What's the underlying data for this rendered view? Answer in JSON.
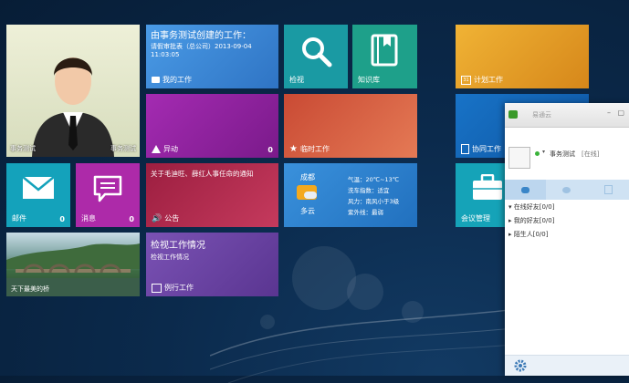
{
  "tiles": {
    "user": {
      "left_name": "事务测试",
      "right_name": "事务测试"
    },
    "workflow": {
      "title": "由事务测试创建的工作：",
      "line1": "请假审批表（总公司）2013-09-04",
      "line2": "11:03:05",
      "label": "我的工作"
    },
    "search": {
      "label": "检视"
    },
    "knowledge": {
      "label": "知识库"
    },
    "plan": {
      "label": "计划工作"
    },
    "exception": {
      "label": "异动",
      "count": "0"
    },
    "temp": {
      "label": "临时工作"
    },
    "collab": {
      "label": "协同工作"
    },
    "mail": {
      "label": "邮件",
      "count": "0"
    },
    "message": {
      "label": "消息",
      "count": "0"
    },
    "notice": {
      "text": "关于毛迪旺、薛红人事任命的通知",
      "label": "公告"
    },
    "weather": {
      "city": "成都",
      "condition": "多云",
      "temp": "气温：20℃~13℃",
      "wash": "洗车指数：适宜",
      "wind": "风力：南风小于3级",
      "uv": "紫外线：最弱"
    },
    "meeting": {
      "label": "会议管理"
    },
    "photo": {
      "caption": "天下最美的桥"
    },
    "review": {
      "title": "检视工作情况",
      "subtitle": "检视工作情况",
      "label": "例行工作"
    }
  },
  "chat": {
    "title": "易通云",
    "user": "事务测试",
    "status": "[在线]",
    "groups": [
      "在线好友[0/0]",
      "我的好友[0/0]",
      "陌生人[0/0]"
    ]
  },
  "colors": {
    "workflow": "#3b86d6",
    "search": "#1a9aa3",
    "knowledge": "#1ea08a",
    "plan": "#e39b21",
    "exception": "#8d1f9a",
    "temp": "#d45a3a",
    "collab": "#0e63b5",
    "mail": "#14a2bb",
    "message": "#ad2aa9",
    "notice": "#b2234a",
    "weather": "#2f83d0",
    "meeting": "#15a3b8",
    "review": "#6a3f9f"
  }
}
